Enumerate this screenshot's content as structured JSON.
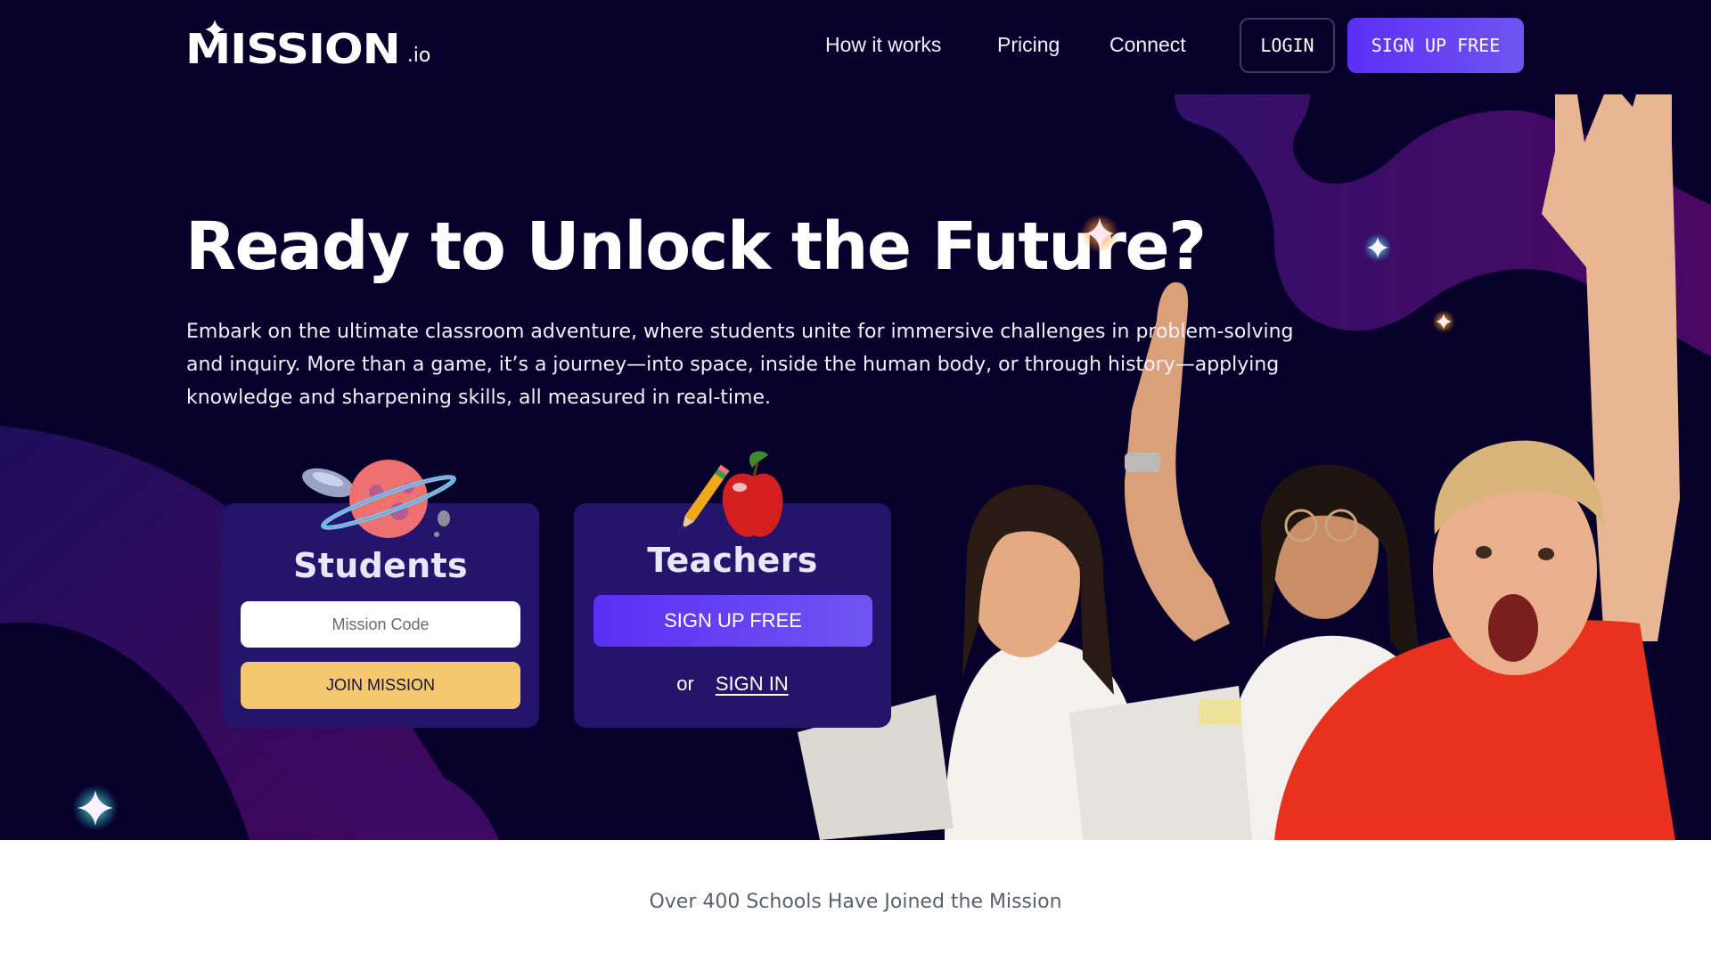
{
  "brand": {
    "name": "MISSION",
    "suffix": ".io"
  },
  "nav": {
    "links": [
      {
        "label": "How it works"
      },
      {
        "label": "Pricing"
      },
      {
        "label": "Connect"
      }
    ],
    "login_label": "LOGIN",
    "signup_label": "SIGN UP FREE"
  },
  "hero": {
    "title": "Ready to Unlock the Future?",
    "intro": "Embark on the ultimate classroom adventure, where students unite for immersive challenges in problem-solving and inquiry. More than a game, it’s a journey—into space, inside the human body, or through history—applying knowledge and sharpening skills, all measured in real-time."
  },
  "students_card": {
    "title": "Students",
    "icon": "planet-ufo-icon",
    "code_placeholder": "Mission Code",
    "code_value": "",
    "join_label": "JOIN MISSION"
  },
  "teachers_card": {
    "title": "Teachers",
    "icon": "apple-pencil-icon",
    "signup_label": "SIGN UP FREE",
    "or_label": "or",
    "signin_label": "SIGN IN"
  },
  "social_proof": {
    "text": "Over 400 Schools Have Joined the Mission"
  },
  "colors": {
    "background": "#07002b",
    "card": "#24146b",
    "accent": "#5b2ff5",
    "join_button": "#f2c76e",
    "blob": "#3d0a63",
    "sparkle_cyan": "#3ee6e6",
    "sparkle_orange": "#ffa63d"
  }
}
